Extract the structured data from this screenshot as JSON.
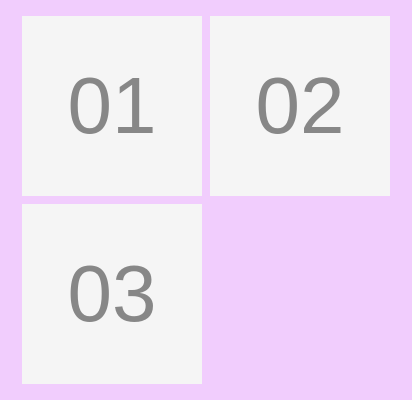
{
  "tiles": [
    {
      "label": "01"
    },
    {
      "label": "02"
    },
    {
      "label": "03"
    }
  ],
  "colors": {
    "background": "#f1cdfd",
    "tile": "#f5f5f5",
    "text": "#878787"
  }
}
